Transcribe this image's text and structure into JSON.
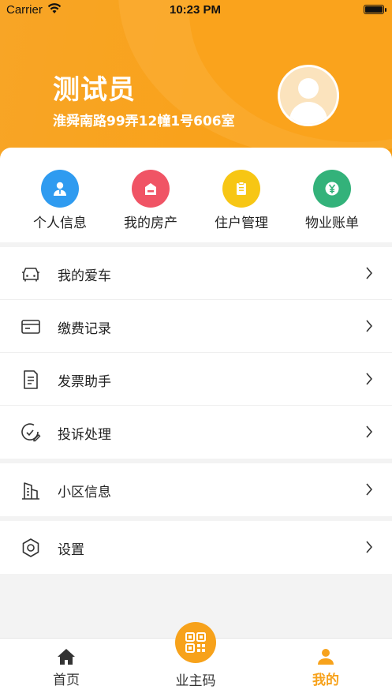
{
  "status_bar": {
    "carrier": "Carrier",
    "time": "10:23 PM"
  },
  "profile": {
    "name": "测试员",
    "address": "淮舜南路99弄12幢1号606室"
  },
  "quick_actions": [
    {
      "label": "个人信息",
      "icon": "person-icon",
      "color": "#2f9bf0"
    },
    {
      "label": "我的房产",
      "icon": "house-icon",
      "color": "#f05465"
    },
    {
      "label": "住户管理",
      "icon": "clipboard-icon",
      "color": "#f7c614"
    },
    {
      "label": "物业账单",
      "icon": "yen-icon",
      "color": "#33b27a"
    }
  ],
  "menu_groups": [
    [
      {
        "label": "我的爱车",
        "icon": "car-icon"
      },
      {
        "label": "缴费记录",
        "icon": "card-icon"
      },
      {
        "label": "发票助手",
        "icon": "invoice-icon"
      },
      {
        "label": "投诉处理",
        "icon": "complaint-icon"
      }
    ],
    [
      {
        "label": "小区信息",
        "icon": "building-icon"
      }
    ],
    [
      {
        "label": "设置",
        "icon": "settings-icon"
      }
    ]
  ],
  "tabs": [
    {
      "label": "首页",
      "icon": "home-icon",
      "active": false
    },
    {
      "label": "业主码",
      "icon": "qr-code-icon",
      "active": false
    },
    {
      "label": "我的",
      "icon": "user-icon",
      "active": true
    }
  ],
  "colors": {
    "accent": "#f7a21b",
    "header": "#f9a21b"
  }
}
